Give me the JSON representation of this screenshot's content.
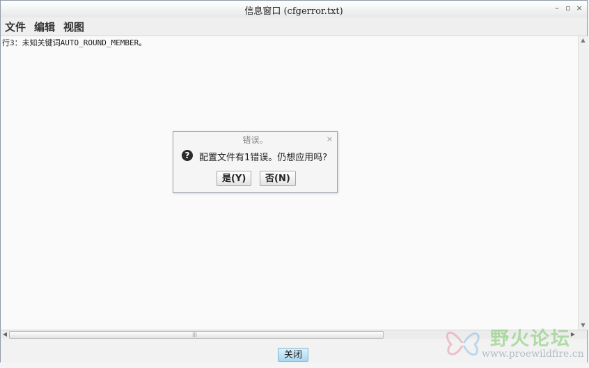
{
  "window": {
    "title": "信息窗口 (cfgerror.txt)",
    "controls": [
      "–",
      "▫",
      "×"
    ]
  },
  "menu": {
    "items": [
      "文件",
      "编辑",
      "视图"
    ]
  },
  "content": {
    "line": "行3：未知关键词AUTO_ROUND_MEMBER。"
  },
  "dialog": {
    "title": "错误。",
    "close": "×",
    "icon": "question-icon",
    "icon_glyph": "?",
    "message": "配置文件有1错误。仍想应用吗?",
    "yes_label": "是(Y)",
    "no_label": "否(N)"
  },
  "footer": {
    "close_label": "关闭"
  },
  "watermark": {
    "title": "野火论坛",
    "url": "www.proewildfire.cn"
  },
  "colors": {
    "close_button": "#a9d7f2",
    "watermark_green": "#78c864"
  }
}
